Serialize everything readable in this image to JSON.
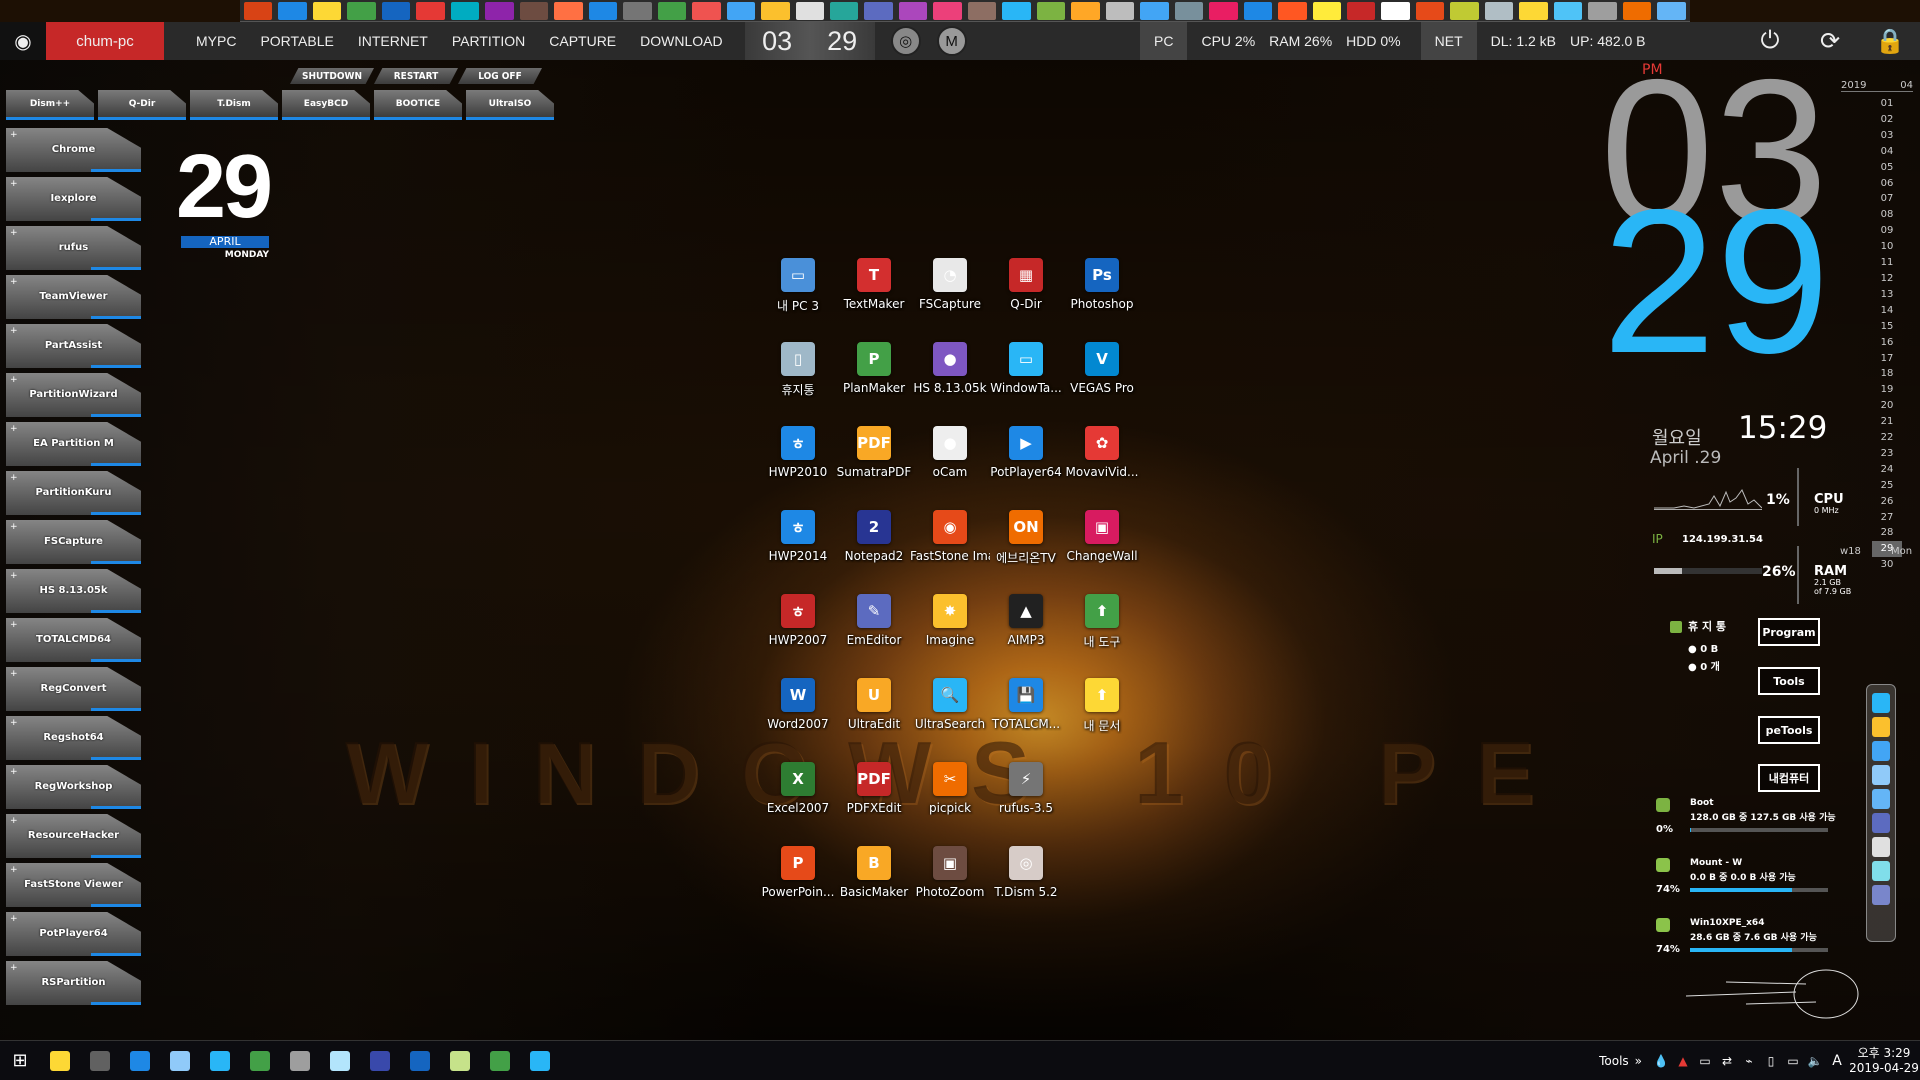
{
  "topbar": {
    "hostname": "chum-pc",
    "menus": [
      "MYPC",
      "PORTABLE",
      "INTERNET",
      "PARTITION",
      "CAPTURE",
      "DOWNLOAD"
    ],
    "clock_hour": "03",
    "clock_minute": "29",
    "pc_tag": "PC",
    "cpu": "CPU  2%",
    "ram": "RAM  26%",
    "hdd": "HDD  0%",
    "net_tag": "NET",
    "dl": "DL: 1.2 kB",
    "up": "UP: 482.0 B"
  },
  "power_row": [
    "SHUTDOWN",
    "RESTART",
    "LOG OFF"
  ],
  "tool_row": [
    "Dism++",
    "Q-Dir",
    "T.Dism",
    "EasyBCD",
    "BOOTICE",
    "UltraISO"
  ],
  "left_tiles": [
    "Chrome",
    "Iexplore",
    "rufus",
    "TeamViewer",
    "PartAssist",
    "PartitionWizard",
    "EA Partition M",
    "PartitionKuru",
    "FSCapture",
    "HS 8.13.05k",
    "TOTALCMD64",
    "RegConvert",
    "Regshot64",
    "RegWorkshop",
    "ResourceHacker",
    "FastStone Viewer",
    "PotPlayer64",
    "RSPartition"
  ],
  "date": {
    "day": "29",
    "month": "APRIL",
    "weekday": "MONDAY"
  },
  "desktop_icons": [
    {
      "name": "내 PC 3",
      "color": "#4a90d9",
      "glyph": "▭"
    },
    {
      "name": "TextMaker",
      "color": "#d32f2f",
      "glyph": "T"
    },
    {
      "name": "FSCapture",
      "color": "#e8e8e8",
      "glyph": "◔"
    },
    {
      "name": "Q-Dir",
      "color": "#c62828",
      "glyph": "▦"
    },
    {
      "name": "Photoshop",
      "color": "#1565c0",
      "glyph": "Ps"
    },
    {
      "name": "휴지통",
      "color": "#9fb8c8",
      "glyph": "▯"
    },
    {
      "name": "PlanMaker",
      "color": "#43a047",
      "glyph": "P"
    },
    {
      "name": "HS 8.13.05k",
      "color": "#7e57c2",
      "glyph": "●"
    },
    {
      "name": "WindowTa...",
      "color": "#29b6f6",
      "glyph": "▭"
    },
    {
      "name": "VEGAS Pro",
      "color": "#0288d1",
      "glyph": "V"
    },
    {
      "name": "HWP2010",
      "color": "#1e88e5",
      "glyph": "ㅎ"
    },
    {
      "name": "SumatraPDF",
      "color": "#f9a825",
      "glyph": "PDF"
    },
    {
      "name": "oCam",
      "color": "#eeeeee",
      "glyph": "●"
    },
    {
      "name": "PotPlayer64",
      "color": "#1e88e5",
      "glyph": "▶"
    },
    {
      "name": "MovaviVid...",
      "color": "#e53935",
      "glyph": "✿"
    },
    {
      "name": "HWP2014",
      "color": "#1e88e5",
      "glyph": "ㅎ"
    },
    {
      "name": "Notepad2",
      "color": "#283593",
      "glyph": "2"
    },
    {
      "name": "FastStone Image ...",
      "color": "#e64a19",
      "glyph": "◉"
    },
    {
      "name": "에브리온TV",
      "color": "#ef6c00",
      "glyph": "ON"
    },
    {
      "name": "ChangeWall",
      "color": "#d81b60",
      "glyph": "▣"
    },
    {
      "name": "HWP2007",
      "color": "#c62828",
      "glyph": "ㅎ"
    },
    {
      "name": "EmEditor",
      "color": "#5c6bc0",
      "glyph": "✎"
    },
    {
      "name": "Imagine",
      "color": "#fbc02d",
      "glyph": "✸"
    },
    {
      "name": "AIMP3",
      "color": "#212121",
      "glyph": "▲"
    },
    {
      "name": "내 도구",
      "color": "#43a047",
      "glyph": "⬆"
    },
    {
      "name": "Word2007",
      "color": "#1565c0",
      "glyph": "W"
    },
    {
      "name": "UltraEdit",
      "color": "#f9a825",
      "glyph": "U"
    },
    {
      "name": "UltraSearch",
      "color": "#29b6f6",
      "glyph": "🔍"
    },
    {
      "name": "TOTALCM...",
      "color": "#1e88e5",
      "glyph": "💾"
    },
    {
      "name": "내 문서",
      "color": "#fdd835",
      "glyph": "⬆"
    },
    {
      "name": "Excel2007",
      "color": "#2e7d32",
      "glyph": "X"
    },
    {
      "name": "PDFXEdit",
      "color": "#c62828",
      "glyph": "PDF"
    },
    {
      "name": "picpick",
      "color": "#ef6c00",
      "glyph": "✂"
    },
    {
      "name": "rufus-3.5",
      "color": "#757575",
      "glyph": "⚡"
    },
    {
      "name": "",
      "color": "transparent",
      "glyph": ""
    },
    {
      "name": "PowerPoin...",
      "color": "#e64a19",
      "glyph": "P"
    },
    {
      "name": "BasicMaker",
      "color": "#f9a825",
      "glyph": "B"
    },
    {
      "name": "PhotoZoom",
      "color": "#6d4c41",
      "glyph": "▣"
    },
    {
      "name": "T.Dism 5.2",
      "color": "#d7ccc8",
      "glyph": "◎"
    }
  ],
  "watermark": "WINDOWS 10 PE",
  "right_clock": {
    "ampm": "PM",
    "hour": "03",
    "minute": "29",
    "korean_weekday": "월요일",
    "english_date": "April .29",
    "time": "15:29"
  },
  "calendar": {
    "year": "2019",
    "month": "04",
    "days": [
      "01",
      "02",
      "03",
      "04",
      "05",
      "06",
      "07",
      "08",
      "09",
      "10",
      "11",
      "12",
      "13",
      "14",
      "15",
      "16",
      "17",
      "18",
      "19",
      "20",
      "21",
      "22",
      "23",
      "24",
      "25",
      "26",
      "27",
      "28",
      "29",
      "30"
    ],
    "today": "29",
    "week": "w18",
    "weekday": "Mon"
  },
  "monitor": {
    "cpu_pct": "1%",
    "cpu_label": "CPU",
    "cpu_mhz": "0 MHz",
    "ip_label": "IP",
    "ip": "124.199.31.54",
    "ram_pct": "26%",
    "ram_fraction": 0.26,
    "ram_label": "RAM",
    "ram_used": "2.1 GB",
    "ram_total": "of 7.9 GB"
  },
  "recycle": {
    "label": "휴 지 통",
    "size": "0 B",
    "count": "0 개"
  },
  "right_buttons": [
    "Program",
    "Tools",
    "peTools",
    "내컴퓨터"
  ],
  "drives": [
    {
      "name": "Boot",
      "info": "128.0 GB 중 127.5 GB 사용 가능",
      "pct": "0%",
      "fill": 0.004
    },
    {
      "name": "Mount - W",
      "info": "0.0 B 중     0.0 B 사용 가능",
      "pct": "74%",
      "fill": 0.74
    },
    {
      "name": "Win10XPE_x64",
      "info": "28.6 GB 중  7.6 GB 사용 가능",
      "pct": "74%",
      "fill": 0.74
    }
  ],
  "taskbar": {
    "tools_label": "Tools",
    "expand": "»",
    "ime": "A",
    "time": "오후 3:29",
    "date": "2019-04-29"
  }
}
